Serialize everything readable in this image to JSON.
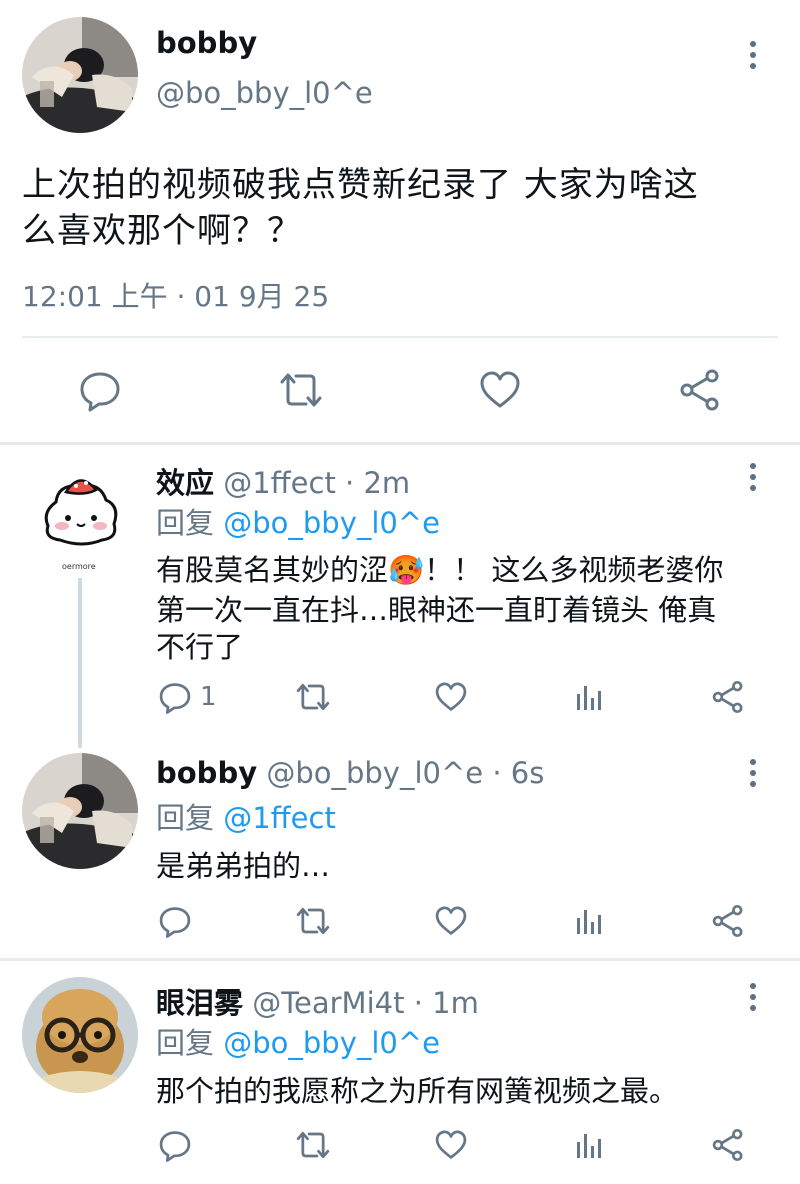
{
  "main_tweet": {
    "display_name": "bobby",
    "handle": "@bo_bby_l0^e",
    "text_line1": "上次拍的视频破我点赞新纪录了 大家为啥这",
    "text_line2": "么喜欢那个啊？？",
    "timestamp": "12:01 上午 · 01 9月 25"
  },
  "replies": [
    {
      "display_name": "效应",
      "handle": "@1ffect",
      "time": "· 2m",
      "reply_prefix": "回复",
      "reply_to": "@bo_bby_l0^e",
      "avatar_caption": "oermore",
      "lines": [
        "有股莫名其妙的涩🥵！！ 这么多视频老婆你",
        "第一次一直在抖…眼神还一直盯着镜头 俺真",
        "不行了"
      ],
      "reply_count": "1"
    },
    {
      "display_name": "bobby",
      "handle": "@bo_bby_l0^e",
      "time": "· 6s",
      "reply_prefix": "回复",
      "reply_to": "@1ffect",
      "lines": [
        "是弟弟拍的…"
      ],
      "reply_count": ""
    },
    {
      "display_name": "眼泪雾",
      "handle": "@TearMi4t",
      "time": "· 1m",
      "reply_prefix": "回复",
      "reply_to": "@bo_bby_l0^e",
      "lines": [
        "那个拍的我愿称之为所有网簧视频之最。"
      ],
      "reply_count": ""
    }
  ],
  "icons": {
    "reply": "reply-icon",
    "retweet": "retweet-icon",
    "like": "heart-icon",
    "analytics": "analytics-icon",
    "share": "share-icon",
    "more": "more-icon"
  },
  "colors": {
    "link": "#1d9bf0",
    "muted": "#657786",
    "icon": "#657786",
    "divider": "#e6ecf0"
  }
}
